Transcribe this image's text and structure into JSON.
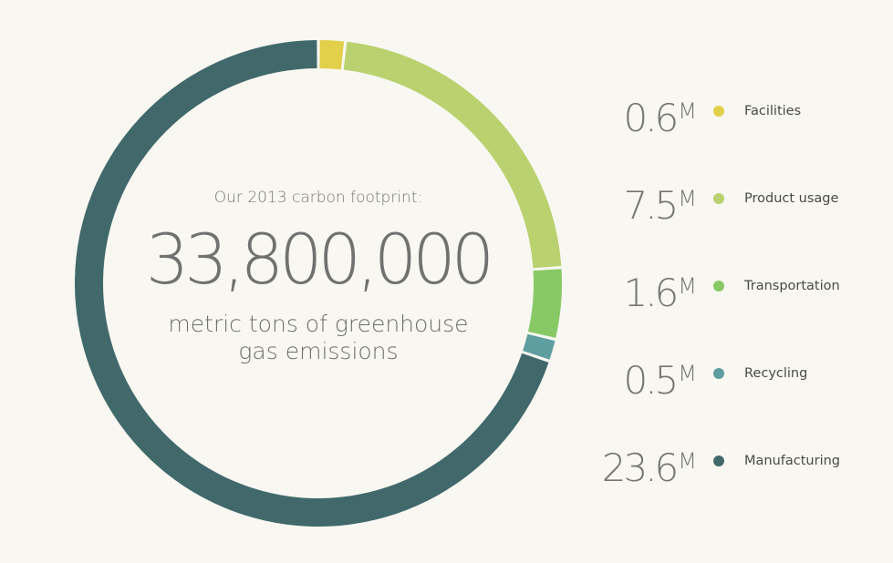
{
  "chart_data": {
    "type": "pie",
    "subtitle": "Our 2013 carbon footprint:",
    "total_label": "33,800,000",
    "caption_line1": "metric tons of greenhouse",
    "caption_line2": "gas emissions",
    "unit": "M",
    "series": [
      {
        "name": "Facilities",
        "value": 0.6,
        "label": "0.6",
        "color": "#e2cf4a"
      },
      {
        "name": "Product usage",
        "value": 7.5,
        "label": "7.5",
        "color": "#b9d26f"
      },
      {
        "name": "Transportation",
        "value": 1.6,
        "label": "1.6",
        "color": "#88c966"
      },
      {
        "name": "Recycling",
        "value": 0.5,
        "label": "0.5",
        "color": "#5e9ea0"
      },
      {
        "name": "Manufacturing",
        "value": 23.6,
        "label": "23.6",
        "color": "#41696b"
      }
    ],
    "legend_position": "right"
  }
}
